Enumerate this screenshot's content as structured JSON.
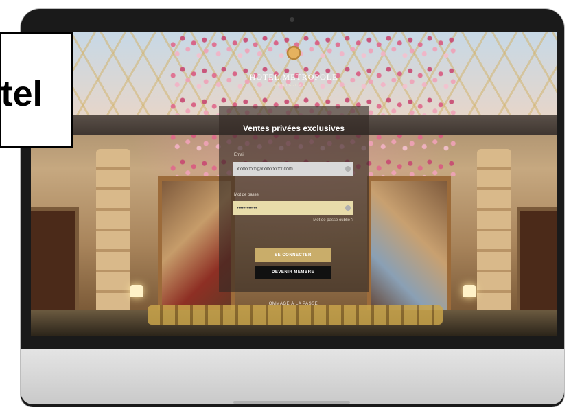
{
  "logo": {
    "name": "HOTEL METROPOLE",
    "tagline": "MONTE-CARLO"
  },
  "login": {
    "title": "Ventes privées exclusives",
    "email_label": "Email",
    "email_value": "xxxxxxxx@xxxxxxxxx.com",
    "password_label": "Mot de passe",
    "password_value": "••••••••••••",
    "forgot_link": "Mot de passe oublié ?",
    "connect_button": "SE CONNECTER",
    "member_button": "DEVENIR MEMBRE"
  },
  "footer": {
    "hommage": "HOMMAGE À LA PASSE"
  },
  "callout": {
    "text": "Hotel"
  },
  "icons": [
    "camera-icon",
    "email-field-icon",
    "password-field-icon",
    "hotel-logo-icon"
  ],
  "colors": {
    "connect_button": "#c9ad6a",
    "member_button": "#111111",
    "password_field": "#e8dcaa",
    "email_field": "#d9d9d9"
  }
}
